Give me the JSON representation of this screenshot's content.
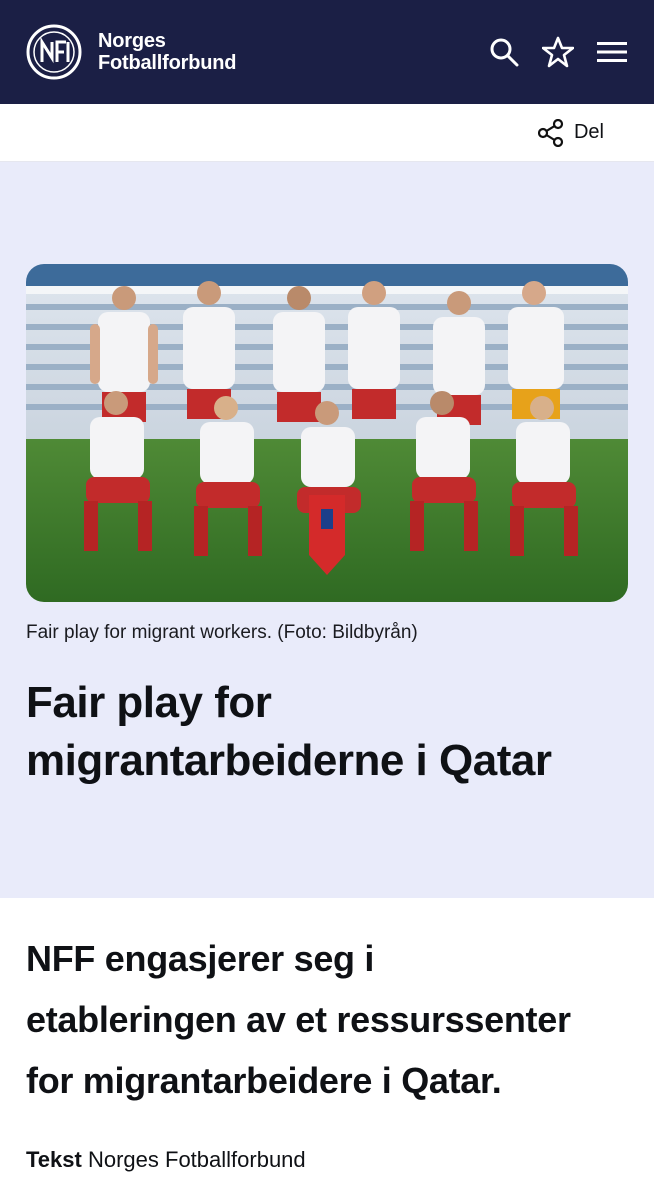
{
  "header": {
    "brand_line1": "Norges",
    "brand_line2": "Fotballforbund",
    "icons": [
      "search-icon",
      "star-icon",
      "menu-icon"
    ],
    "bg_color": "#1b1f45"
  },
  "sharebar": {
    "share_label": "Del",
    "icon": "share-icon"
  },
  "hero": {
    "bg_color": "#e9ebfa",
    "caption": "Fair play for migrant workers. (Foto: Bildbyrån)",
    "title_line1": "Fair play for",
    "title_line2": "migrantarbeiderne i Qatar"
  },
  "article": {
    "lead_line1": "NFF engasjerer seg i",
    "lead_line2": "etableringen av et ressurssenter",
    "lead_line3": "for migrantarbeidere i Qatar.",
    "byline_label": "Tekst",
    "byline_value": "Norges Fotballforbund"
  }
}
